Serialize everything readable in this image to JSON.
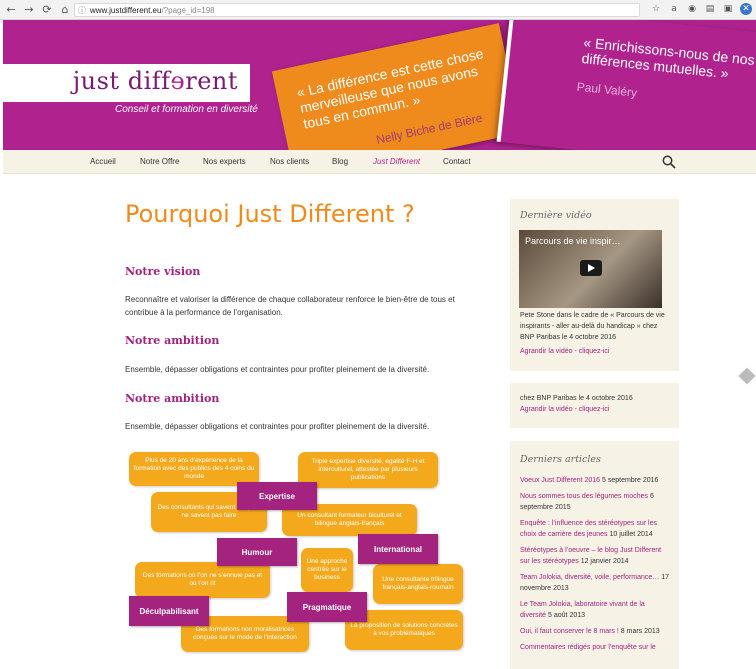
{
  "browser": {
    "url_host": "www.justdifferent.eu",
    "url_path": "/?page_id=198"
  },
  "header": {
    "logo_part1": "just diff",
    "logo_part2": "ɘ",
    "logo_part3": "rent",
    "tagline": "Conseil et formation en diversité",
    "quote1": "« La différence est cette chose merveilleuse que nous avons tous en commun. »",
    "quote1_author": "Nelly Biche de Bière",
    "quote2": "« Enrichissons-nous de nos différences mutuelles. »",
    "quote2_author": "Paul Valéry"
  },
  "menu": {
    "items": [
      "Accueil",
      "Notre Offre",
      "Nos experts",
      "Nos clients",
      "Blog",
      "Just Different",
      "Contact"
    ],
    "active": "Just Different"
  },
  "main": {
    "title": "Pourquoi Just Different ?",
    "sections": [
      {
        "heading": "Notre vision",
        "text": "Reconnaître et valoriser la différence de chaque collaborateur renforce le bien-être de tous et contribue à la performance de l’organisation."
      },
      {
        "heading": "Notre ambition",
        "text": "Ensemble, dépasser obligations et contraintes pour profiter pleinement de la diversité."
      },
      {
        "heading": "Notre ambition",
        "text": "Ensemble, dépasser obligations et contraintes pour profiter pleinement de la diversité."
      }
    ]
  },
  "diagram": {
    "orange": [
      "Plus de 20 ans d’expérience de la formation avec des publics des 4 coins du monde",
      "Triple expertise diversité, égalité F-H et interculturel, attestée par plusieurs publications",
      "Des consultants qui savent ce qu’ils ne savent pas faire",
      "Un consultant formateur biculturel et bilingue anglais-français",
      "Une approche centrée sur le business",
      "Des formations où l’on ne s’ennuie pas et où l’on rit",
      "Une consultante trilingue français-anglais-roumain",
      "Des formations non moralisatrices conçues sur le mode de l’interaction",
      "La proposition de solutions concrètes à vos problématiques"
    ],
    "purple": [
      "Expertise",
      "Humour",
      "International",
      "Déculpabilisant",
      "Pragmatique"
    ]
  },
  "sidebar": {
    "video": {
      "title": "Dernière vidéo",
      "video_title": "Parcours de vie inspir…",
      "desc": "Pete Stone dans le cadre de « Parcours de vie inspirants - aller au-delà du handicap » chez BNP Paribas le 4 octobre 2016",
      "link": "Agrandir la vidéo - cliquez-ici"
    },
    "video2": {
      "desc": "chez BNP Paribas le 4 octobre 2016",
      "link": "Agrandir la vidéo - cliquez-ici"
    },
    "articles": {
      "title": "Derniers articles",
      "items": [
        {
          "title": "Voeux Just Different 2016",
          "date": "5 septembre 2016"
        },
        {
          "title": "Nous sommes tous des légumes moches",
          "date": "6 septembre 2015"
        },
        {
          "title": "Enquête : l’influence des stéréotypes sur les choix de carrière des jeunes",
          "date": "10 juillet 2014"
        },
        {
          "title": "Stéréotypes à l’oeuvre – le blog Just Different sur les stéréotypes",
          "date": "12 janvier 2014"
        },
        {
          "title": "Team Jolokia, diversité, voile, performance…",
          "date": "17 novembre 2013"
        },
        {
          "title": "Le Team Jolokia, laboratoire vivant de la diversité",
          "date": "5 août 2013"
        },
        {
          "title": "Oui, il faut conserver le 8 mars !",
          "date": "8 mars 2013"
        },
        {
          "title": "Commentaires rédigés pour l’enquête sur le",
          "date": ""
        }
      ]
    }
  },
  "colors": {
    "purple": "#b0238f",
    "orange": "#ef8a1c",
    "cream": "#f6f2e6"
  }
}
